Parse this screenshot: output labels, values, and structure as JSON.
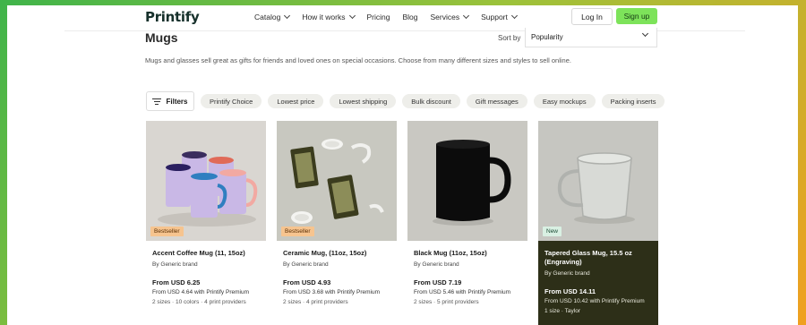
{
  "header": {
    "logo": "Printify",
    "nav": [
      {
        "label": "Catalog",
        "has_chevron": true
      },
      {
        "label": "How it works",
        "has_chevron": true
      },
      {
        "label": "Pricing",
        "has_chevron": false
      },
      {
        "label": "Blog",
        "has_chevron": false
      },
      {
        "label": "Services",
        "has_chevron": true
      },
      {
        "label": "Support",
        "has_chevron": true
      }
    ],
    "login": "Log In",
    "signup": "Sign up",
    "signup_color": "#7de35a"
  },
  "main": {
    "title": "Mugs",
    "sort_label": "Sort by",
    "sort_value": "Popularity",
    "description": "Mugs and glasses sell great as gifts for friends and loved ones on special occasions. Choose from many different sizes and styles to sell online."
  },
  "filters": {
    "button": "Filters",
    "chips": [
      "Printify Choice",
      "Lowest price",
      "Lowest shipping",
      "Bulk discount",
      "Gift messages",
      "Easy mockups",
      "Packing inserts"
    ]
  },
  "products": [
    {
      "name": "Accent Coffee Mug (11, 15oz)",
      "brand": "By Generic brand",
      "price": "From USD 6.25",
      "premium": "From USD 4.64 with Printify Premium",
      "meta": "2 sizes · 10 colors · 4 print providers",
      "badge": "Bestseller"
    },
    {
      "name": "Ceramic Mug, (11oz, 15oz)",
      "brand": "By Generic brand",
      "price": "From USD 4.93",
      "premium": "From USD 3.68 with Printify Premium",
      "meta": "2 sizes · 4 print providers",
      "badge": "Bestseller"
    },
    {
      "name": "Black Mug (11oz, 15oz)",
      "brand": "By Generic brand",
      "price": "From USD 7.19",
      "premium": "From USD 5.46 with Printify Premium",
      "meta": "2 sizes · 5 print providers",
      "badge": ""
    },
    {
      "name": "Tapered Glass Mug, 15.5 oz (Engraving)",
      "brand": "By Generic brand",
      "price": "From USD 14.11",
      "premium": "From USD 10.42 with Printify Premium",
      "meta": "1 size · Taylor",
      "badge": "New"
    }
  ]
}
